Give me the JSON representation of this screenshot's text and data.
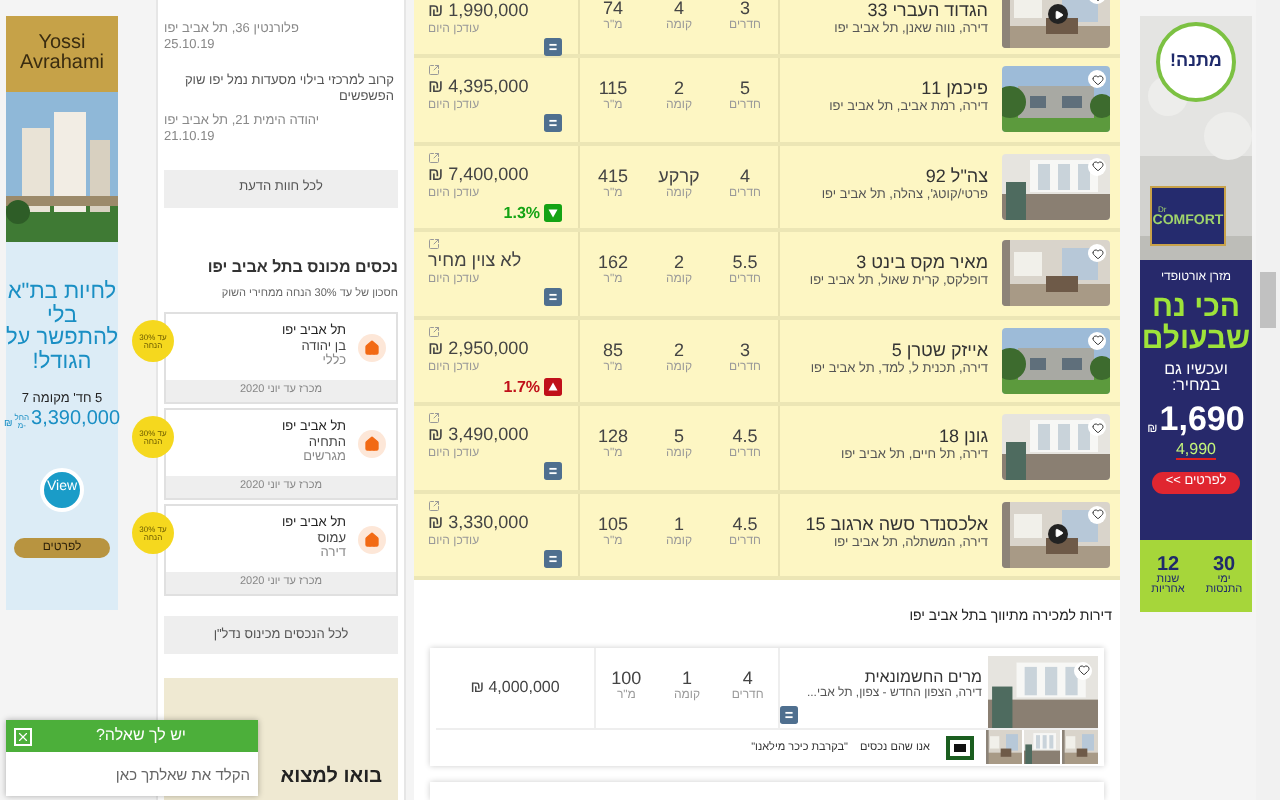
{
  "left_ad": {
    "brand_line1": "Yossi",
    "brand_line2": "Avrahami",
    "headline": "לחיות בת\"א בלי להתפשר על הגודל!",
    "details": "5 חד' מקומה 7",
    "price_prefix": "החל מ-",
    "price": "3,390,000",
    "currency": "₪",
    "view": "View",
    "cta": "לפרטים"
  },
  "news": [
    {
      "address": "פלורנטין 36, תל אביב יפו",
      "date": "25.10.19"
    },
    {
      "text": "קרוב למרכזי בילוי מסעדות נמל יפו שוק הפשפשים",
      "address": "יהודה הימית 21, תל אביב יפו",
      "date": "21.10.19"
    }
  ],
  "reviews_button": "לכל חוות הדעת",
  "foreclosures": {
    "title": "נכסים מכונס בתל אביב יפו",
    "subtitle": "חסכון של עד 30% הנחה ממחירי השוק",
    "button": "לכל הנכסים מכינוס נדל\"ן",
    "items": [
      {
        "city": "תל אביב יפו",
        "street": "בן יהודה",
        "type": "כללי",
        "deadline": "מכרז עד יוני 2020",
        "badge_top": "עד 30%",
        "badge_bottom": "הנחה"
      },
      {
        "city": "תל אביב יפו",
        "street": "התחיה",
        "type": "מגרשים",
        "deadline": "מכרז עד יוני 2020",
        "badge_top": "עד 30%",
        "badge_bottom": "הנחה"
      },
      {
        "city": "תל אביב יפו",
        "street": "עמוס",
        "type": "דירה",
        "deadline": "מכרז עד יוני 2020",
        "badge_top": "עד 30%",
        "badge_bottom": "הנחה"
      }
    ]
  },
  "promo": {
    "headline": "בואו למצוא"
  },
  "chat": {
    "title": "יש לך שאלה?",
    "placeholder": "הקלד את שאלתך כאן"
  },
  "listings": [
    {
      "title": "הגדוד העברי 33",
      "subtitle": "דירה, נווה שאנן, תל אביב יפו",
      "price": "1,990,000 ₪",
      "updated": "עודכן היום",
      "change": {
        "kind": "same"
      },
      "video": true,
      "specs": [
        {
          "value": "3",
          "label": "חדרים"
        },
        {
          "value": "4",
          "label": "קומה"
        },
        {
          "value": "74",
          "label": "מ\"ר"
        }
      ]
    },
    {
      "title": "פיכמן 11",
      "subtitle": "דירה, רמת אביב, תל אביב יפו",
      "price": "4,395,000 ₪",
      "updated": "עודכן היום",
      "change": {
        "kind": "same"
      },
      "video": false,
      "specs": [
        {
          "value": "5",
          "label": "חדרים"
        },
        {
          "value": "2",
          "label": "קומה"
        },
        {
          "value": "115",
          "label": "מ\"ר"
        }
      ]
    },
    {
      "title": "צה\"ל 92",
      "subtitle": "פרטי/קוטג', צהלה, תל אביב יפו",
      "price": "7,400,000 ₪",
      "updated": "עודכן היום",
      "change": {
        "kind": "down",
        "text": "1.3%"
      },
      "video": false,
      "specs": [
        {
          "value": "4",
          "label": "חדרים"
        },
        {
          "value": "קרקע",
          "label": "קומה"
        },
        {
          "value": "415",
          "label": "מ\"ר"
        }
      ]
    },
    {
      "title": "מאיר מקס בינט 3",
      "subtitle": "דופלקס, קרית שאול, תל אביב יפו",
      "price": "לא צוין מחיר",
      "updated": "עודכן היום",
      "change": {
        "kind": "same"
      },
      "video": false,
      "specs": [
        {
          "value": "5.5",
          "label": "חדרים"
        },
        {
          "value": "2",
          "label": "קומה"
        },
        {
          "value": "162",
          "label": "מ\"ר"
        }
      ]
    },
    {
      "title": "אייזק שטרן 5",
      "subtitle": "דירה, תכנית ל, למד, תל אביב יפו",
      "price": "2,950,000 ₪",
      "updated": "עודכן היום",
      "change": {
        "kind": "up",
        "text": "1.7%"
      },
      "video": false,
      "specs": [
        {
          "value": "3",
          "label": "חדרים"
        },
        {
          "value": "2",
          "label": "קומה"
        },
        {
          "value": "85",
          "label": "מ\"ר"
        }
      ]
    },
    {
      "title": "גונן 18",
      "subtitle": "דירה, תל חיים, תל אביב יפו",
      "price": "3,490,000 ₪",
      "updated": "עודכן היום",
      "change": {
        "kind": "same"
      },
      "video": false,
      "specs": [
        {
          "value": "4.5",
          "label": "חדרים"
        },
        {
          "value": "5",
          "label": "קומה"
        },
        {
          "value": "128",
          "label": "מ\"ר"
        }
      ]
    },
    {
      "title": "אלכסנדר סשה ארגוב 15",
      "subtitle": "דירה, המשתלה, תל אביב יפו",
      "price": "3,330,000 ₪",
      "updated": "עודכן היום",
      "change": {
        "kind": "same"
      },
      "video": true,
      "specs": [
        {
          "value": "4.5",
          "label": "חדרים"
        },
        {
          "value": "1",
          "label": "קומה"
        },
        {
          "value": "105",
          "label": "מ\"ר"
        }
      ]
    }
  ],
  "agency_section": {
    "title": "דירות למכירה מתיווך בתל אביב יפו",
    "card": {
      "title": "מרים החשמונאית",
      "subtitle": "דירה, הצפון החדש - צפון, תל אבי...",
      "price": "4,000,000 ₪",
      "change": {
        "kind": "same"
      },
      "agency": "אנו שהם נכסים",
      "slogan": "\"בקרבת כיכר מילאנו\"",
      "specs": [
        {
          "value": "4",
          "label": "חדרים"
        },
        {
          "value": "1",
          "label": "קומה"
        },
        {
          "value": "100",
          "label": "מ\"ר"
        }
      ]
    }
  },
  "right_ad": {
    "bubble": "מתנה!",
    "logo_small": "Dr",
    "logo": "COMFORT",
    "kicker": "מזרן אורטופדי",
    "headline": "הכי נח שבעולם",
    "subhead": "ועכשיו גם במחיר:",
    "price": "1,690",
    "currency": "₪",
    "old_price": "4,990",
    "cta": "לפרטים >>",
    "perks": [
      {
        "number": "30",
        "label": "ימי התנסות"
      },
      {
        "number": "12",
        "label": "שנות אחריות"
      }
    ]
  }
}
